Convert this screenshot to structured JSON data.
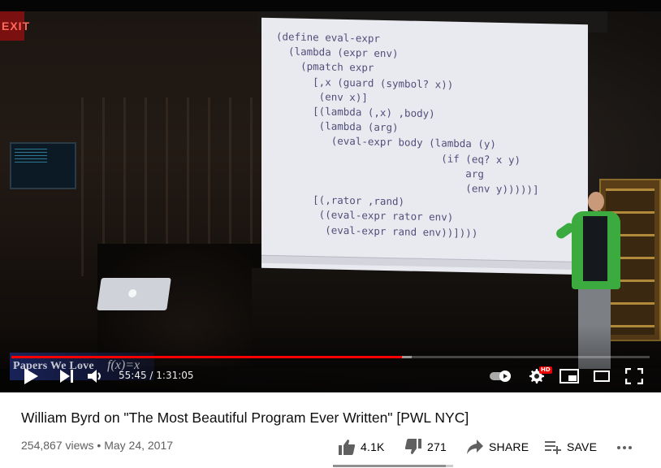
{
  "video": {
    "title": "William Byrd on \"The Most Beautiful Program Ever Written\" [PWL NYC]",
    "views": "254,867 views",
    "separator": "•",
    "date": "May 24, 2017"
  },
  "player": {
    "current_time": "55:45",
    "time_separator": "/",
    "duration": "1:31:05",
    "played_fraction": 0.612,
    "buffered_fraction": 0.627,
    "hd_badge": "HD",
    "accent_color": "#ff0000"
  },
  "scene": {
    "exit_sign": "EXIT",
    "slide_code": [
      "(define eval-expr",
      "  (lambda (expr env)",
      "    (pmatch expr",
      "      [,x (guard (symbol? x))",
      "       (env x)]",
      "      [(lambda (,x) ,body)",
      "       (lambda (arg)",
      "         (eval-expr body (lambda (y)",
      "                           (if (eq? x y)",
      "                               arg",
      "                               (env y)))))]",
      "      [(,rator ,rand)",
      "       ((eval-expr rator env)",
      "        (eval-expr rand env))])))"
    ],
    "watermark_text": "Papers We Love",
    "watermark_fx": "f(x)=x"
  },
  "actions": {
    "likes": "4.1K",
    "dislikes": "271",
    "share_label": "SHARE",
    "save_label": "SAVE",
    "like_ratio": 0.938
  },
  "icons": {
    "play": "play-icon",
    "next": "next-icon",
    "volume": "volume-icon",
    "autoplay": "autoplay-toggle-icon",
    "settings": "gear-icon",
    "miniplayer": "miniplayer-icon",
    "theater": "theater-mode-icon",
    "fullscreen": "fullscreen-icon",
    "like": "thumbs-up-icon",
    "dislike": "thumbs-down-icon",
    "share": "share-arrow-icon",
    "save": "playlist-add-icon",
    "more": "more-horizontal-icon"
  }
}
